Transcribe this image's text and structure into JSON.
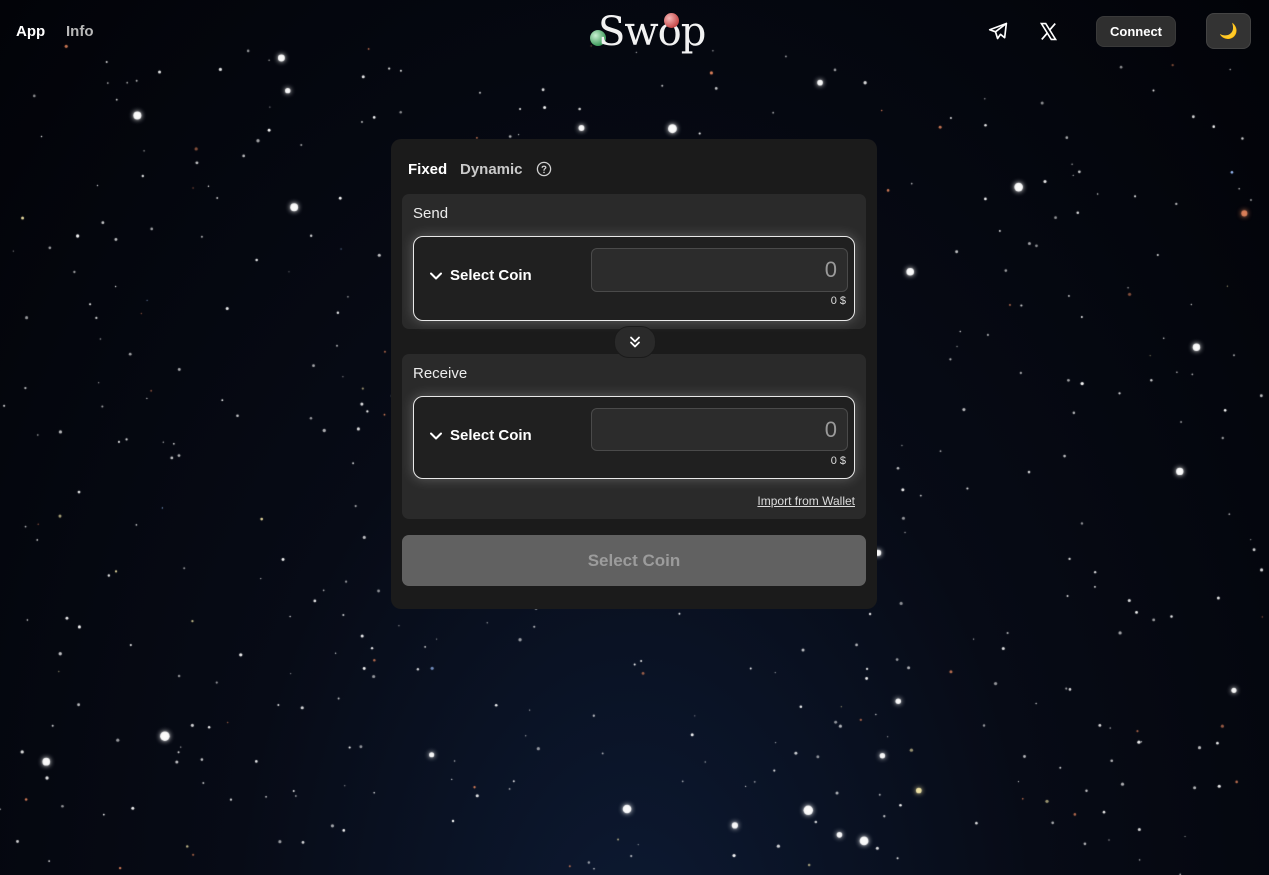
{
  "nav": {
    "app_label": "App",
    "info_label": "Info"
  },
  "logo": {
    "text": "Swop"
  },
  "header": {
    "connect_label": "Connect",
    "theme_icon": "moon-icon",
    "social_icons": [
      "telegram-icon",
      "x-icon"
    ]
  },
  "mode_tabs": {
    "fixed": "Fixed",
    "dynamic": "Dynamic",
    "active": "Fixed"
  },
  "send": {
    "label": "Send",
    "coin_label": "Select Coin",
    "amount_placeholder": "0",
    "usd_value": "0 $"
  },
  "receive": {
    "label": "Receive",
    "coin_label": "Select Coin",
    "amount_placeholder": "0",
    "usd_value": "0 $"
  },
  "import_wallet_label": "Import from Wallet",
  "action_button_label": "Select Coin",
  "colors": {
    "background": "#05070f",
    "card": "#1b1b1b",
    "panel": "#2a2a2a",
    "disabled_button": "#616161"
  }
}
